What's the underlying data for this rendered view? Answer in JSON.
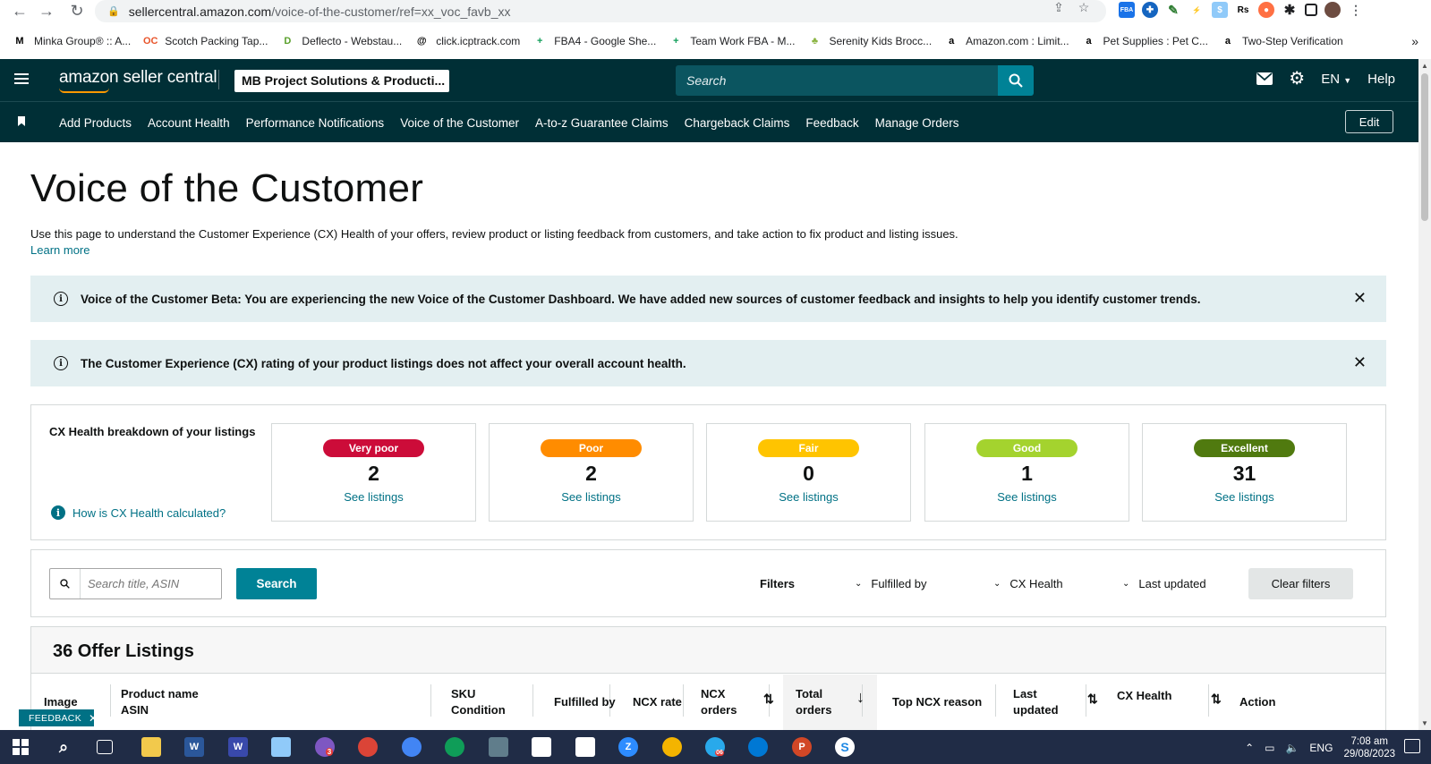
{
  "browser": {
    "url_host": "sellercentral.amazon.com",
    "url_path": "/voice-of-the-customer/ref=xx_voc_favb_xx",
    "bookmarks": [
      {
        "label": "Minka Group® :: A...",
        "icon": "M",
        "color": "#000000"
      },
      {
        "label": "Scotch Packing Tap...",
        "icon": "OC",
        "color": "#e8542a"
      },
      {
        "label": "Deflecto - Webstau...",
        "icon": "D",
        "color": "#5aa02c"
      },
      {
        "label": "click.icptrack.com",
        "icon": "@",
        "color": "#000000"
      },
      {
        "label": "FBA4 - Google She...",
        "icon": "+",
        "color": "#0f9d58"
      },
      {
        "label": "Team Work FBA - M...",
        "icon": "+",
        "color": "#0f9d58"
      },
      {
        "label": "Serenity Kids Brocc...",
        "icon": "♣",
        "color": "#8bb443"
      },
      {
        "label": "Amazon.com : Limit...",
        "icon": "a",
        "color": "#000000"
      },
      {
        "label": "Pet Supplies : Pet C...",
        "icon": "a",
        "color": "#000000"
      },
      {
        "label": "Two-Step Verification",
        "icon": "a",
        "color": "#000000"
      }
    ],
    "bookmarks_more": "»"
  },
  "header": {
    "logo_text": "amazon seller central",
    "account_name": "MB Project Solutions & Producti...",
    "search_placeholder": "Search",
    "language": "EN",
    "help": "Help"
  },
  "nav": {
    "items": [
      "Add Products",
      "Account Health",
      "Performance Notifications",
      "Voice of the Customer",
      "A-to-z Guarantee Claims",
      "Chargeback Claims",
      "Feedback",
      "Manage Orders"
    ],
    "edit": "Edit"
  },
  "page": {
    "title": "Voice of the Customer",
    "description": "Use this page to understand the Customer Experience (CX) Health of your offers, review product or listing feedback from customers, and take action to fix product and listing issues.",
    "learn_more": "Learn more",
    "alerts": [
      "Voice of the Customer Beta: You are experiencing the new Voice of the Customer Dashboard. We have added new sources of customer feedback and insights to help you identify customer trends.",
      "The Customer Experience (CX) rating of your product listings does not affect your overall account health."
    ]
  },
  "cx": {
    "title": "CX Health breakdown of your listings",
    "help_link": "How is CX Health calculated?",
    "cards": [
      {
        "label": "Very poor",
        "count": "2",
        "link": "See listings",
        "bg": "#cc0c39",
        "fg": "#ffffff"
      },
      {
        "label": "Poor",
        "count": "2",
        "link": "See listings",
        "bg": "#ff8c00",
        "fg": "#ffffff"
      },
      {
        "label": "Fair",
        "count": "0",
        "link": "See listings",
        "bg": "#ffc400",
        "fg": "#ffffff"
      },
      {
        "label": "Good",
        "count": "1",
        "link": "See listings",
        "bg": "#a4d32e",
        "fg": "#ffffff"
      },
      {
        "label": "Excellent",
        "count": "31",
        "link": "See listings",
        "bg": "#507a0f",
        "fg": "#ffffff"
      }
    ]
  },
  "filters": {
    "search_placeholder": "Search title, ASIN",
    "search_button": "Search",
    "label": "Filters",
    "dropdowns": [
      "Fulfilled by",
      "CX Health",
      "Last updated"
    ],
    "clear": "Clear filters"
  },
  "listings": {
    "title": "36 Offer Listings",
    "columns": [
      {
        "l1": "Image",
        "l2": ""
      },
      {
        "l1": "Product name",
        "l2": "ASIN"
      },
      {
        "l1": "SKU",
        "l2": "Condition"
      },
      {
        "l1": "Fulfilled by",
        "l2": ""
      },
      {
        "l1": "NCX rate",
        "l2": ""
      },
      {
        "l1": "NCX",
        "l2": "orders"
      },
      {
        "l1": "Total",
        "l2": "orders"
      },
      {
        "l1": "Top NCX reason",
        "l2": ""
      },
      {
        "l1": "Last",
        "l2": "updated"
      },
      {
        "l1": "CX Health",
        "l2": ""
      },
      {
        "l1": "Action",
        "l2": ""
      }
    ]
  },
  "feedback_tab": "FEEDBACK",
  "taskbar": {
    "language": "ENG",
    "time": "7:08 am",
    "date": "29/08/2023",
    "badges": {
      "app3": "3",
      "app_telegram": "06"
    }
  }
}
